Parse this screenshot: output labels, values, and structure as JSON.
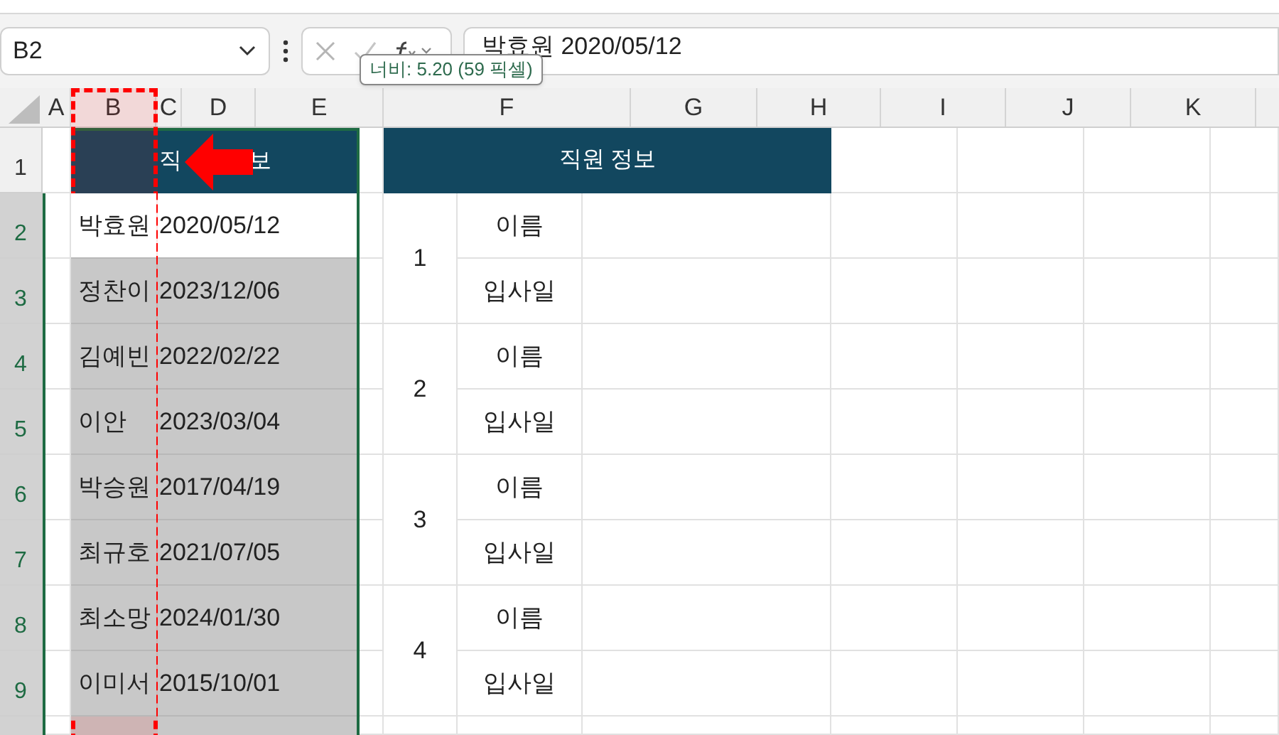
{
  "name_box": "B2",
  "formula": "박효원 2020/05/12",
  "tooltip": "너비: 5.20 (59 픽셀)",
  "columns": [
    "A",
    "B",
    "C",
    "D",
    "E",
    "F",
    "G",
    "H",
    "I",
    "J",
    "K"
  ],
  "rows": [
    {
      "label": "1",
      "selected": false
    },
    {
      "label": "2",
      "selected": true
    },
    {
      "label": "3",
      "selected": true
    },
    {
      "label": "4",
      "selected": true
    },
    {
      "label": "5",
      "selected": true
    },
    {
      "label": "6",
      "selected": true
    },
    {
      "label": "7",
      "selected": true
    },
    {
      "label": "8",
      "selected": true
    },
    {
      "label": "9",
      "selected": true
    }
  ],
  "left_table": {
    "header_parts": [
      "직",
      "보"
    ],
    "entries": [
      {
        "name": "박효원",
        "date": "2020/05/12",
        "active": true
      },
      {
        "name": "정찬이",
        "date": "2023/12/06",
        "active": false
      },
      {
        "name": "김예빈",
        "date": "2022/02/22",
        "active": false
      },
      {
        "name": "이안",
        "date": "2023/03/04",
        "active": false
      },
      {
        "name": "박승원",
        "date": "2017/04/19",
        "active": false
      },
      {
        "name": "최규호",
        "date": "2021/07/05",
        "active": false
      },
      {
        "name": "최소망",
        "date": "2024/01/30",
        "active": false
      },
      {
        "name": "이미서",
        "date": "2015/10/01",
        "active": false
      }
    ]
  },
  "right_table": {
    "title": "직원 정보",
    "groups": [
      {
        "number": "1",
        "fields": [
          "이름",
          "입사일"
        ]
      },
      {
        "number": "2",
        "fields": [
          "이름",
          "입사일"
        ]
      },
      {
        "number": "3",
        "fields": [
          "이름",
          "입사일"
        ]
      },
      {
        "number": "4",
        "fields": [
          "이름",
          "입사일"
        ]
      }
    ]
  }
}
